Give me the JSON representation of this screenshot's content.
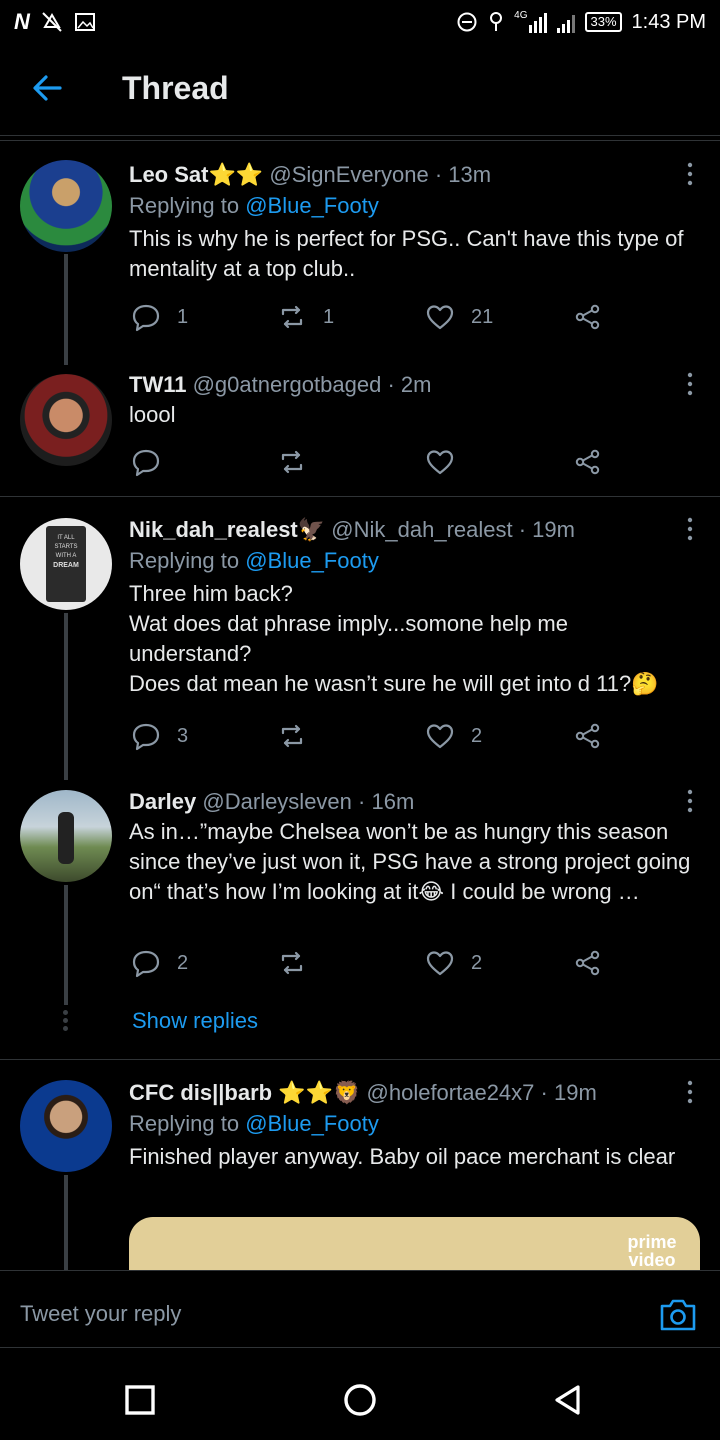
{
  "status_bar": {
    "left_icons": [
      "netflix-icon",
      "notification-off-icon",
      "image-icon"
    ],
    "right_icons": [
      "dnd-icon",
      "location-icon",
      "signal-4g-icon",
      "signal-icon"
    ],
    "network": "4G",
    "battery": "33%",
    "time": "1:43 PM"
  },
  "header": {
    "title": "Thread"
  },
  "tweets": [
    {
      "name": "Leo Sat⭐⭐",
      "handle": "@SignEveryone",
      "time": "· 13m",
      "replying_label": "Replying to",
      "replying_to": "@Blue_Footy",
      "text": "This is why he is perfect for PSG.. Can't have this type of mentality at a top club..",
      "replies": "1",
      "retweets": "1",
      "likes": "21"
    },
    {
      "name": "TW11",
      "handle": "@g0atnergotbaged",
      "time": "· 2m",
      "text": "loool",
      "replies": "",
      "retweets": "",
      "likes": ""
    },
    {
      "name": "Nik_dah_realest🦅",
      "handle": "@Nik_dah_realest",
      "time": "· 19m",
      "replying_label": "Replying to",
      "replying_to": "@Blue_Footy",
      "text": "Three him back?\nWat does dat phrase imply...somone help me understand?\nDoes dat mean he wasn’t sure he will get into d 11?🤔",
      "replies": "3",
      "retweets": "",
      "likes": "2",
      "avatar_text": [
        "IT ALL STARTS",
        "WITH A",
        "DREAM"
      ]
    },
    {
      "name": "Darley",
      "handle": "@Darleysleven",
      "time": "· 16m",
      "text": "As in…”maybe Chelsea won’t be as hungry this season since they’ve just won it, PSG have a strong project going on“ that’s how I’m looking at it😂 I could be wrong …",
      "replies": "2",
      "retweets": "",
      "likes": "2",
      "show_replies": "Show replies"
    },
    {
      "name": "CFC dis||barb ⭐⭐🦁",
      "handle": "@holefortae24x7",
      "time": "· 19m",
      "replying_label": "Replying to",
      "replying_to": "@Blue_Footy",
      "text": "Finished player anyway. Baby oil pace merchant is clear",
      "media_label": "prime video"
    }
  ],
  "reply_bar": {
    "placeholder": "Tweet your reply"
  },
  "nav": [
    "recents-button",
    "home-button",
    "back-button"
  ],
  "colors": {
    "accent": "#1d9bf0",
    "background": "#000000",
    "muted": "#8b98a5",
    "divider": "#2f3336"
  }
}
